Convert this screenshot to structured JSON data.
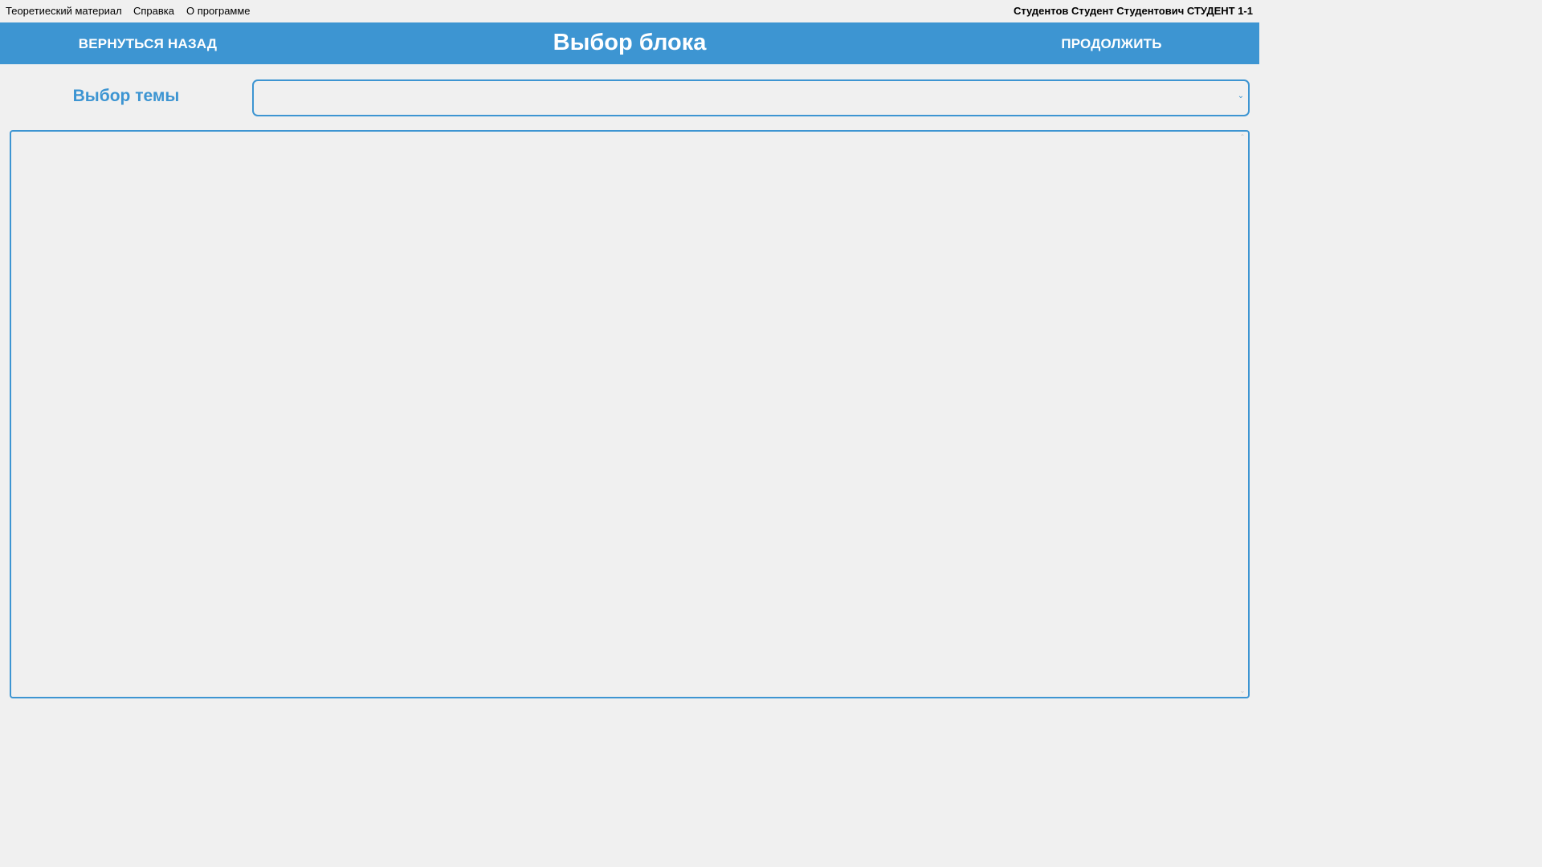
{
  "menu": {
    "items": [
      {
        "label": "Теоретиеский материал"
      },
      {
        "label": "Справка"
      },
      {
        "label": "О программе"
      }
    ],
    "user": "Студентов Студент Студентович СТУДЕНТ 1-1"
  },
  "header": {
    "back_label": "ВЕРНУТЬСЯ НАЗАД",
    "title": "Выбор блока",
    "continue_label": "ПРОДОЛЖИТЬ"
  },
  "topic": {
    "label": "Выбор темы",
    "selected_value": ""
  },
  "colors": {
    "accent": "#3d95d2",
    "background": "#f0f0f0",
    "header_text": "#ffffff"
  },
  "icons": {
    "select_chevron": "chevron-down-icon",
    "scroll_up": "scroll-up-icon",
    "scroll_down": "scroll-down-icon"
  }
}
